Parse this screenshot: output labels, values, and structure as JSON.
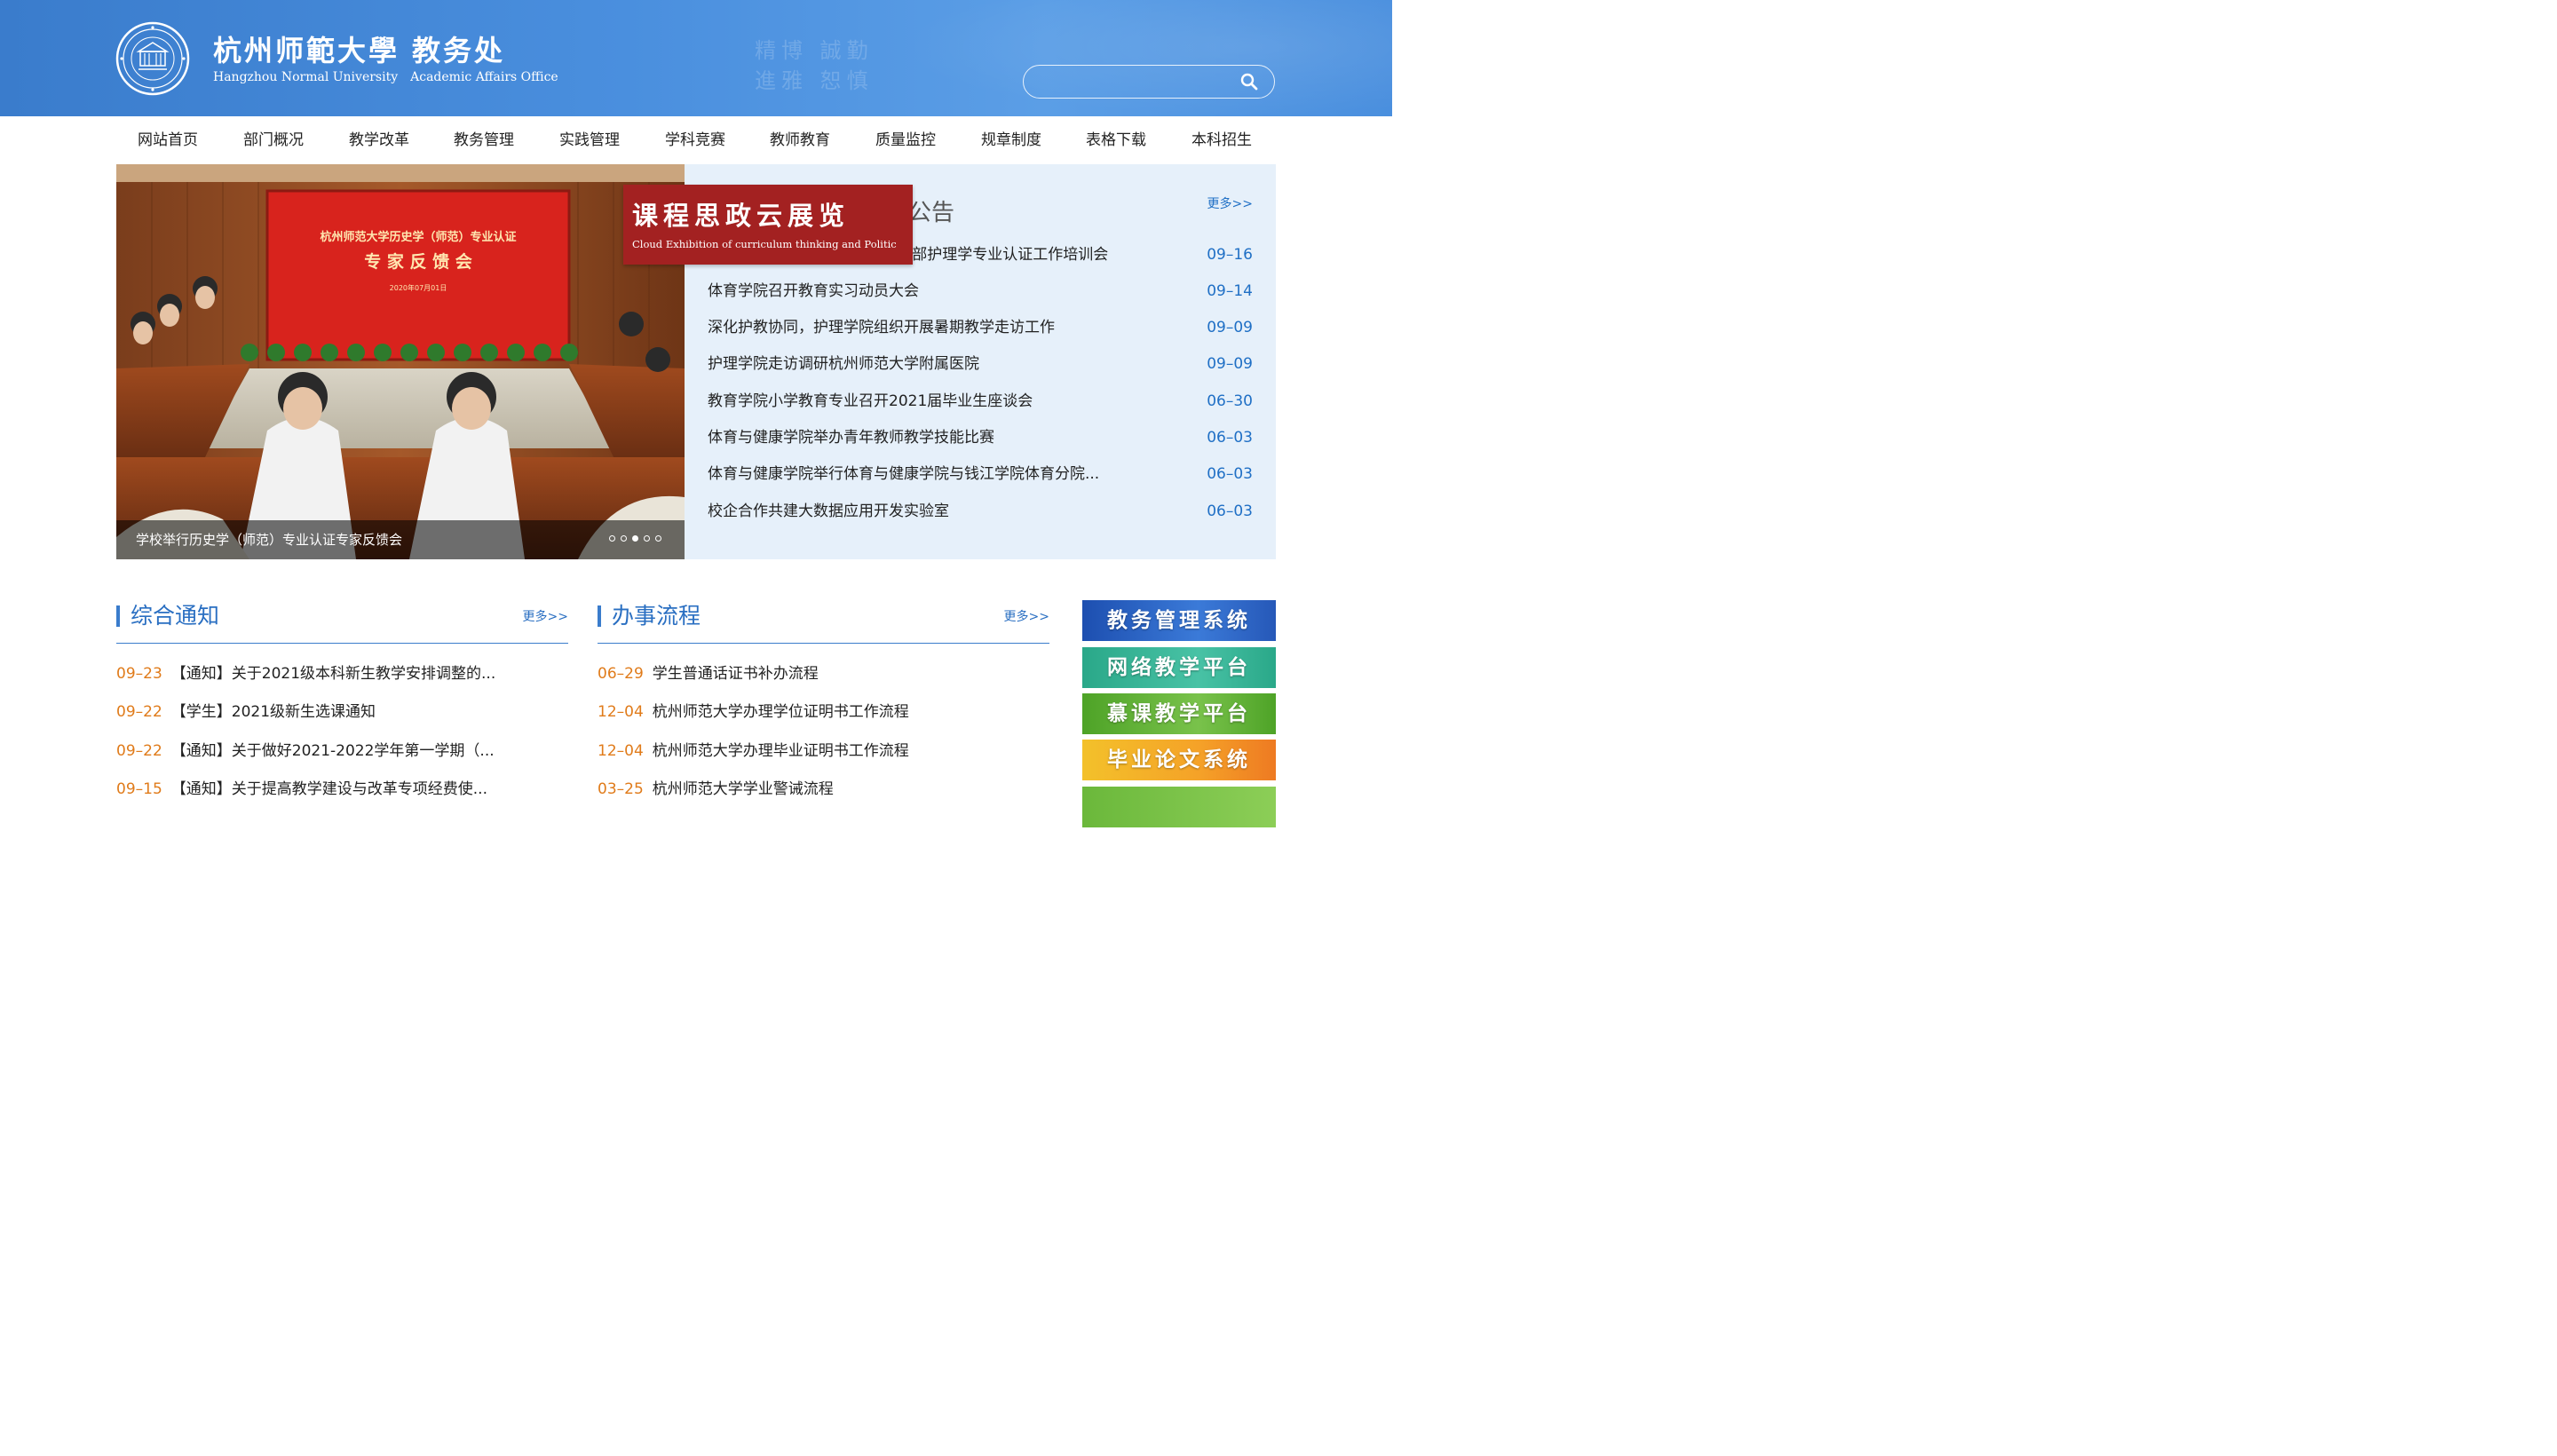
{
  "header": {
    "title_cn": "杭州师範大學",
    "title_office": "教务处",
    "title_en": "Hangzhou Normal University",
    "title_en_office": "Academic Affairs Office",
    "search_placeholder": ""
  },
  "nav": [
    "网站首页",
    "部门概况",
    "教学改革",
    "教务管理",
    "实践管理",
    "学科竞赛",
    "教师教育",
    "质量监控",
    "规章制度",
    "表格下载",
    "本科招生"
  ],
  "slider": {
    "caption": "学校举行历史学（师范）专业认证专家反馈会",
    "dots_total": 5,
    "dot_active": 3,
    "screen_line1": "杭州师范大学历史学（师范）专业认证",
    "screen_line2": "专 家 反 馈 会",
    "screen_line3": "2020年07月01日"
  },
  "banner": {
    "title": "课程思政云展览",
    "subtitle": "Cloud Exhibition of curriculum thinking and Politic"
  },
  "announcements": {
    "title": "公告",
    "more": "更多>>",
    "items": [
      {
        "title": "护理学院组织参加2021年教育部护理学专业认证工作培训会",
        "date": "09–16"
      },
      {
        "title": "体育学院召开教育实习动员大会",
        "date": "09–14"
      },
      {
        "title": "深化护教协同，护理学院组织开展暑期教学走访工作",
        "date": "09–09"
      },
      {
        "title": "护理学院走访调研杭州师范大学附属医院",
        "date": "09–09"
      },
      {
        "title": "教育学院小学教育专业召开2021届毕业生座谈会",
        "date": "06–30"
      },
      {
        "title": "体育与健康学院举办青年教师教学技能比赛",
        "date": "06–03"
      },
      {
        "title": "体育与健康学院举行体育与健康学院与钱江学院体育分院...",
        "date": "06–03"
      },
      {
        "title": "校企合作共建大数据应用开发实验室",
        "date": "06–03"
      }
    ]
  },
  "notices": {
    "title": "综合通知",
    "more": "更多>>",
    "items": [
      {
        "date": "09–23",
        "text": "【通知】关于2021级本科新生教学安排调整的..."
      },
      {
        "date": "09–22",
        "text": "【学生】2021级新生选课通知"
      },
      {
        "date": "09–22",
        "text": "【通知】关于做好2021-2022学年第一学期（..."
      },
      {
        "date": "09–15",
        "text": "【通知】关于提高教学建设与改革专项经费使..."
      }
    ]
  },
  "procedures": {
    "title": "办事流程",
    "more": "更多>>",
    "items": [
      {
        "date": "06–29",
        "text": "学生普通话证书补办流程"
      },
      {
        "date": "12–04",
        "text": "杭州师范大学办理学位证明书工作流程"
      },
      {
        "date": "12–04",
        "text": "杭州师范大学办理毕业证明书工作流程"
      },
      {
        "date": "03–25",
        "text": "杭州师范大学学业警诫流程"
      }
    ]
  },
  "systems": [
    "教务管理系统",
    "网络教学平台",
    "慕课教学平台",
    "毕业论文系统",
    ""
  ]
}
